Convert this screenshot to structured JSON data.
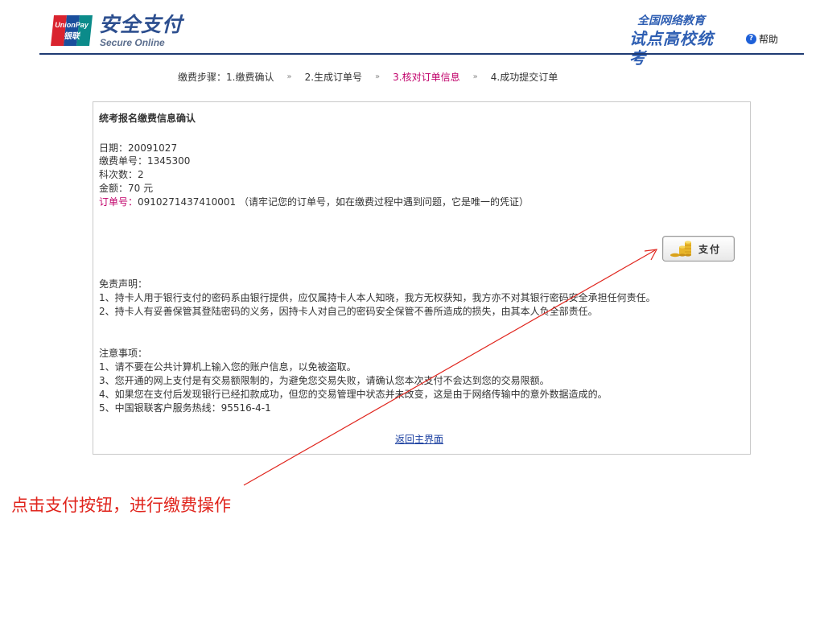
{
  "header": {
    "logo_text_top": "UnionPay",
    "logo_text_bottom": "银联",
    "brand_cn": "安全支付",
    "brand_en": "Secure Online",
    "right_top": "全国网络教育",
    "right_big": "试点高校统考",
    "help_label": "帮助",
    "help_icon": "?"
  },
  "steps": {
    "prefix": "缴费步骤：",
    "items": [
      "1.缴费确认",
      "2.生成订单号",
      "3.核对订单信息",
      "4.成功提交订单"
    ],
    "separator": "»",
    "active_index": 2
  },
  "confirm": {
    "title": "统考报名缴费信息确认",
    "date": "日期：20091027",
    "bill_no": "缴费单号：1345300",
    "subject_count": "科次数：2",
    "amount": "金额：70 元",
    "order_label": "订单号：",
    "order_value": "0910271437410001 （请牢记您的订单号，如在缴费过程中遇到问题，它是唯一的凭证）"
  },
  "pay_button": {
    "label": "支付"
  },
  "disclaimer": {
    "title": "免责声明：",
    "items": [
      "1、持卡人用于银行支付的密码系由银行提供，应仅属持卡人本人知晓，我方无权获知，我方亦不对其银行密码安全承担任何责任。",
      "2、持卡人有妥善保管其登陆密码的义务，因持卡人对自己的密码安全保管不善所造成的损失，由其本人负全部责任。"
    ]
  },
  "notes": {
    "title": "注意事项：",
    "items": [
      "1、请不要在公共计算机上输入您的账户信息，以免被盗取。",
      "3、您开通的网上支付是有交易额限制的，为避免您交易失败，请确认您本次支付不会达到您的交易限额。",
      "4、如果您在支付后发现银行已经扣款成功，但您的交易管理中状态并未改变，这是由于网络传输中的意外数据造成的。",
      "5、中国银联客户服务热线：95516-4-1"
    ]
  },
  "back_link": "返回主界面",
  "annotation": "点击支付按钮，进行缴费操作",
  "colors": {
    "accent_blue": "#2f5fb3",
    "highlight": "#c0006a",
    "annotation": "#e0251d"
  }
}
